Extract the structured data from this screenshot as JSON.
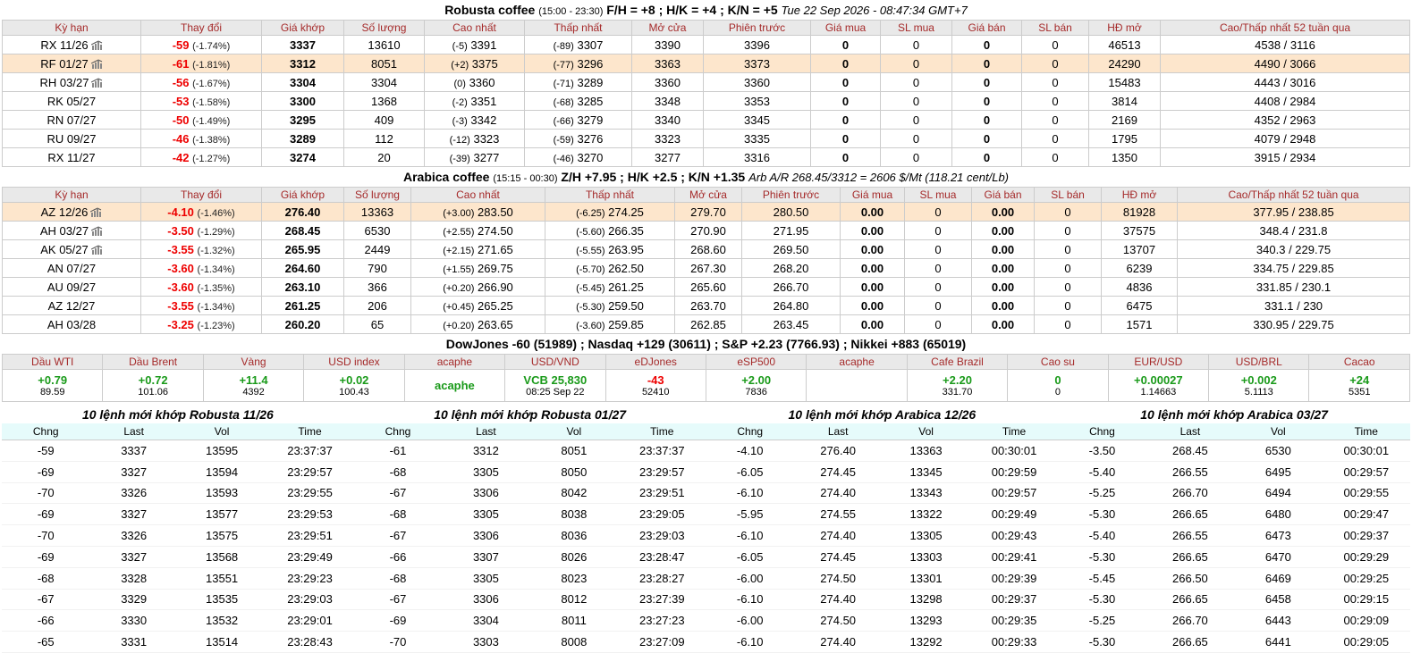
{
  "robusta": {
    "title_name": "Robusta coffee",
    "title_hours": "(15:00 - 23:30)",
    "title_spreads": "F/H = +8 ; H/K = +4 ; K/N = +5",
    "title_time": "Tue 22 Sep 2026 - 08:47:34 GMT+7",
    "headers": [
      "Kỳ hạn",
      "Thay đổi",
      "Giá khớp",
      "Số lượng",
      "Cao nhất",
      "Thấp nhất",
      "Mở cửa",
      "Phiên trước",
      "Giá mua",
      "SL mua",
      "Giá bán",
      "SL bán",
      "HĐ mở",
      "Cao/Thấp nhất 52 tuần qua"
    ],
    "rows": [
      {
        "term": "RX 11/26",
        "chart": true,
        "chg": "-59",
        "pct": "(-1.74%)",
        "price": "3337",
        "vol": "13610",
        "hi_d": "(-5)",
        "hi": "3391",
        "lo_d": "(-89)",
        "lo": "3307",
        "open": "3390",
        "prev": "3396",
        "bid": "0",
        "bid_q": "0",
        "ask": "0",
        "ask_q": "0",
        "oi": "46513",
        "w52": "4538 / 3116",
        "hl": false
      },
      {
        "term": "RF 01/27",
        "chart": true,
        "chg": "-61",
        "pct": "(-1.81%)",
        "price": "3312",
        "vol": "8051",
        "hi_d": "(+2)",
        "hi": "3375",
        "lo_d": "(-77)",
        "lo": "3296",
        "open": "3363",
        "prev": "3373",
        "bid": "0",
        "bid_q": "0",
        "ask": "0",
        "ask_q": "0",
        "oi": "24290",
        "w52": "4490 / 3066",
        "hl": true
      },
      {
        "term": "RH 03/27",
        "chart": true,
        "chg": "-56",
        "pct": "(-1.67%)",
        "price": "3304",
        "vol": "3304",
        "hi_d": "(0)",
        "hi": "3360",
        "lo_d": "(-71)",
        "lo": "3289",
        "open": "3360",
        "prev": "3360",
        "bid": "0",
        "bid_q": "0",
        "ask": "0",
        "ask_q": "0",
        "oi": "15483",
        "w52": "4443 / 3016",
        "hl": false
      },
      {
        "term": "RK 05/27",
        "chart": false,
        "chg": "-53",
        "pct": "(-1.58%)",
        "price": "3300",
        "vol": "1368",
        "hi_d": "(-2)",
        "hi": "3351",
        "lo_d": "(-68)",
        "lo": "3285",
        "open": "3348",
        "prev": "3353",
        "bid": "0",
        "bid_q": "0",
        "ask": "0",
        "ask_q": "0",
        "oi": "3814",
        "w52": "4408 / 2984",
        "hl": false
      },
      {
        "term": "RN 07/27",
        "chart": false,
        "chg": "-50",
        "pct": "(-1.49%)",
        "price": "3295",
        "vol": "409",
        "hi_d": "(-3)",
        "hi": "3342",
        "lo_d": "(-66)",
        "lo": "3279",
        "open": "3340",
        "prev": "3345",
        "bid": "0",
        "bid_q": "0",
        "ask": "0",
        "ask_q": "0",
        "oi": "2169",
        "w52": "4352 / 2963",
        "hl": false
      },
      {
        "term": "RU 09/27",
        "chart": false,
        "chg": "-46",
        "pct": "(-1.38%)",
        "price": "3289",
        "vol": "112",
        "hi_d": "(-12)",
        "hi": "3323",
        "lo_d": "(-59)",
        "lo": "3276",
        "open": "3323",
        "prev": "3335",
        "bid": "0",
        "bid_q": "0",
        "ask": "0",
        "ask_q": "0",
        "oi": "1795",
        "w52": "4079 / 2948",
        "hl": false
      },
      {
        "term": "RX 11/27",
        "chart": false,
        "chg": "-42",
        "pct": "(-1.27%)",
        "price": "3274",
        "vol": "20",
        "hi_d": "(-39)",
        "hi": "3277",
        "lo_d": "(-46)",
        "lo": "3270",
        "open": "3277",
        "prev": "3316",
        "bid": "0",
        "bid_q": "0",
        "ask": "0",
        "ask_q": "0",
        "oi": "1350",
        "w52": "3915 / 2934",
        "hl": false
      }
    ]
  },
  "arabica": {
    "title_name": "Arabica coffee",
    "title_hours": "(15:15 - 00:30)",
    "title_spreads": "Z/H +7.95 ; H/K +2.5 ; K/N +1.35",
    "title_time": "Arb A/R 268.45/3312 = 2606 $/Mt (118.21 cent/Lb)",
    "headers": [
      "Kỳ hạn",
      "Thay đổi",
      "Giá khớp",
      "Số lượng",
      "Cao nhất",
      "Thấp nhất",
      "Mở cửa",
      "Phiên trước",
      "Giá mua",
      "SL mua",
      "Giá bán",
      "SL bán",
      "HĐ mở",
      "Cao/Thấp nhất 52 tuần qua"
    ],
    "rows": [
      {
        "term": "AZ 12/26",
        "chart": true,
        "chg": "-4.10",
        "pct": "(-1.46%)",
        "price": "276.40",
        "vol": "13363",
        "hi_d": "(+3.00)",
        "hi": "283.50",
        "lo_d": "(-6.25)",
        "lo": "274.25",
        "open": "279.70",
        "prev": "280.50",
        "bid": "0.00",
        "bid_q": "0",
        "ask": "0.00",
        "ask_q": "0",
        "oi": "81928",
        "w52": "377.95 / 238.85",
        "hl": true
      },
      {
        "term": "AH 03/27",
        "chart": true,
        "chg": "-3.50",
        "pct": "(-1.29%)",
        "price": "268.45",
        "vol": "6530",
        "hi_d": "(+2.55)",
        "hi": "274.50",
        "lo_d": "(-5.60)",
        "lo": "266.35",
        "open": "270.90",
        "prev": "271.95",
        "bid": "0.00",
        "bid_q": "0",
        "ask": "0.00",
        "ask_q": "0",
        "oi": "37575",
        "w52": "348.4 / 231.8",
        "hl": false
      },
      {
        "term": "AK 05/27",
        "chart": true,
        "chg": "-3.55",
        "pct": "(-1.32%)",
        "price": "265.95",
        "vol": "2449",
        "hi_d": "(+2.15)",
        "hi": "271.65",
        "lo_d": "(-5.55)",
        "lo": "263.95",
        "open": "268.60",
        "prev": "269.50",
        "bid": "0.00",
        "bid_q": "0",
        "ask": "0.00",
        "ask_q": "0",
        "oi": "13707",
        "w52": "340.3 / 229.75",
        "hl": false
      },
      {
        "term": "AN 07/27",
        "chart": false,
        "chg": "-3.60",
        "pct": "(-1.34%)",
        "price": "264.60",
        "vol": "790",
        "hi_d": "(+1.55)",
        "hi": "269.75",
        "lo_d": "(-5.70)",
        "lo": "262.50",
        "open": "267.30",
        "prev": "268.20",
        "bid": "0.00",
        "bid_q": "0",
        "ask": "0.00",
        "ask_q": "0",
        "oi": "6239",
        "w52": "334.75 / 229.85",
        "hl": false
      },
      {
        "term": "AU 09/27",
        "chart": false,
        "chg": "-3.60",
        "pct": "(-1.35%)",
        "price": "263.10",
        "vol": "366",
        "hi_d": "(+0.20)",
        "hi": "266.90",
        "lo_d": "(-5.45)",
        "lo": "261.25",
        "open": "265.60",
        "prev": "266.70",
        "bid": "0.00",
        "bid_q": "0",
        "ask": "0.00",
        "ask_q": "0",
        "oi": "4836",
        "w52": "331.85 / 230.1",
        "hl": false
      },
      {
        "term": "AZ 12/27",
        "chart": false,
        "chg": "-3.55",
        "pct": "(-1.34%)",
        "price": "261.25",
        "vol": "206",
        "hi_d": "(+0.45)",
        "hi": "265.25",
        "lo_d": "(-5.30)",
        "lo": "259.50",
        "open": "263.70",
        "prev": "264.80",
        "bid": "0.00",
        "bid_q": "0",
        "ask": "0.00",
        "ask_q": "0",
        "oi": "6475",
        "w52": "331.1 / 230",
        "hl": false
      },
      {
        "term": "AH 03/28",
        "chart": false,
        "chg": "-3.25",
        "pct": "(-1.23%)",
        "price": "260.20",
        "vol": "65",
        "hi_d": "(+0.20)",
        "hi": "263.65",
        "lo_d": "(-3.60)",
        "lo": "259.85",
        "open": "262.85",
        "prev": "263.45",
        "bid": "0.00",
        "bid_q": "0",
        "ask": "0.00",
        "ask_q": "0",
        "oi": "1571",
        "w52": "330.95 / 229.75",
        "hl": false
      }
    ]
  },
  "indices": {
    "title": "DowJones -60 (51989) ; Nasdaq +129 (30611) ; S&P +2.23 (7766.93) ; Nikkei +883 (65019)",
    "cells": [
      {
        "label": "Dầu WTI",
        "main": "+0.79",
        "sub": "89.59",
        "color": "g"
      },
      {
        "label": "Dầu Brent",
        "main": "+0.72",
        "sub": "101.06",
        "color": "g"
      },
      {
        "label": "Vàng",
        "main": "+11.4",
        "sub": "4392",
        "color": "g"
      },
      {
        "label": "USD index",
        "main": "+0.02",
        "sub": "100.43",
        "color": "g"
      },
      {
        "label": "acaphe",
        "main": "acaphe",
        "sub": "",
        "color": "g"
      },
      {
        "label": "USD/VND",
        "main": "VCB 25,830",
        "sub": "08:25 Sep 22",
        "color": "g"
      },
      {
        "label": "eDJones",
        "main": "-43",
        "sub": "52410",
        "color": "r"
      },
      {
        "label": "eSP500",
        "main": "+2.00",
        "sub": "7836",
        "color": "g"
      },
      {
        "label": "acaphe",
        "main": "",
        "sub": "",
        "color": "g"
      },
      {
        "label": "Cafe Brazil",
        "main": "+2.20",
        "sub": "331.70",
        "color": "g"
      },
      {
        "label": "Cao su",
        "main": "0",
        "sub": "0",
        "color": "g"
      },
      {
        "label": "EUR/USD",
        "main": "+0.00027",
        "sub": "1.14663",
        "color": "g"
      },
      {
        "label": "USD/BRL",
        "main": "+0.002",
        "sub": "5.1113",
        "color": "g"
      },
      {
        "label": "Cacao",
        "main": "+24",
        "sub": "5351",
        "color": "g"
      }
    ]
  },
  "trades": {
    "headers": [
      "Chng",
      "Last",
      "Vol",
      "Time"
    ],
    "blocks": [
      {
        "title": "10 lệnh mới khớp Robusta 11/26",
        "rows": [
          [
            "-59",
            "3337",
            "13595",
            "23:37:37"
          ],
          [
            "-69",
            "3327",
            "13594",
            "23:29:57"
          ],
          [
            "-70",
            "3326",
            "13593",
            "23:29:55"
          ],
          [
            "-69",
            "3327",
            "13577",
            "23:29:53"
          ],
          [
            "-70",
            "3326",
            "13575",
            "23:29:51"
          ],
          [
            "-69",
            "3327",
            "13568",
            "23:29:49"
          ],
          [
            "-68",
            "3328",
            "13551",
            "23:29:23"
          ],
          [
            "-67",
            "3329",
            "13535",
            "23:29:03"
          ],
          [
            "-66",
            "3330",
            "13532",
            "23:29:01"
          ],
          [
            "-65",
            "3331",
            "13514",
            "23:28:43"
          ]
        ]
      },
      {
        "title": "10 lệnh mới khớp Robusta 01/27",
        "rows": [
          [
            "-61",
            "3312",
            "8051",
            "23:37:37"
          ],
          [
            "-68",
            "3305",
            "8050",
            "23:29:57"
          ],
          [
            "-67",
            "3306",
            "8042",
            "23:29:51"
          ],
          [
            "-68",
            "3305",
            "8038",
            "23:29:05"
          ],
          [
            "-67",
            "3306",
            "8036",
            "23:29:03"
          ],
          [
            "-66",
            "3307",
            "8026",
            "23:28:47"
          ],
          [
            "-68",
            "3305",
            "8023",
            "23:28:27"
          ],
          [
            "-67",
            "3306",
            "8012",
            "23:27:39"
          ],
          [
            "-69",
            "3304",
            "8011",
            "23:27:23"
          ],
          [
            "-70",
            "3303",
            "8008",
            "23:27:09"
          ]
        ]
      },
      {
        "title": "10 lệnh mới khớp Arabica 12/26",
        "rows": [
          [
            "-4.10",
            "276.40",
            "13363",
            "00:30:01"
          ],
          [
            "-6.05",
            "274.45",
            "13345",
            "00:29:59"
          ],
          [
            "-6.10",
            "274.40",
            "13343",
            "00:29:57"
          ],
          [
            "-5.95",
            "274.55",
            "13322",
            "00:29:49"
          ],
          [
            "-6.10",
            "274.40",
            "13305",
            "00:29:43"
          ],
          [
            "-6.05",
            "274.45",
            "13303",
            "00:29:41"
          ],
          [
            "-6.00",
            "274.50",
            "13301",
            "00:29:39"
          ],
          [
            "-6.10",
            "274.40",
            "13298",
            "00:29:37"
          ],
          [
            "-6.00",
            "274.50",
            "13293",
            "00:29:35"
          ],
          [
            "-6.10",
            "274.40",
            "13292",
            "00:29:33"
          ]
        ]
      },
      {
        "title": "10 lệnh mới khớp Arabica 03/27",
        "rows": [
          [
            "-3.50",
            "268.45",
            "6530",
            "00:30:01"
          ],
          [
            "-5.40",
            "266.55",
            "6495",
            "00:29:57"
          ],
          [
            "-5.25",
            "266.70",
            "6494",
            "00:29:55"
          ],
          [
            "-5.30",
            "266.65",
            "6480",
            "00:29:47"
          ],
          [
            "-5.40",
            "266.55",
            "6473",
            "00:29:37"
          ],
          [
            "-5.30",
            "266.65",
            "6470",
            "00:29:29"
          ],
          [
            "-5.45",
            "266.50",
            "6469",
            "00:29:25"
          ],
          [
            "-5.30",
            "266.65",
            "6458",
            "00:29:15"
          ],
          [
            "-5.25",
            "266.70",
            "6443",
            "00:29:09"
          ],
          [
            "-5.30",
            "266.65",
            "6441",
            "00:29:05"
          ]
        ]
      }
    ]
  }
}
